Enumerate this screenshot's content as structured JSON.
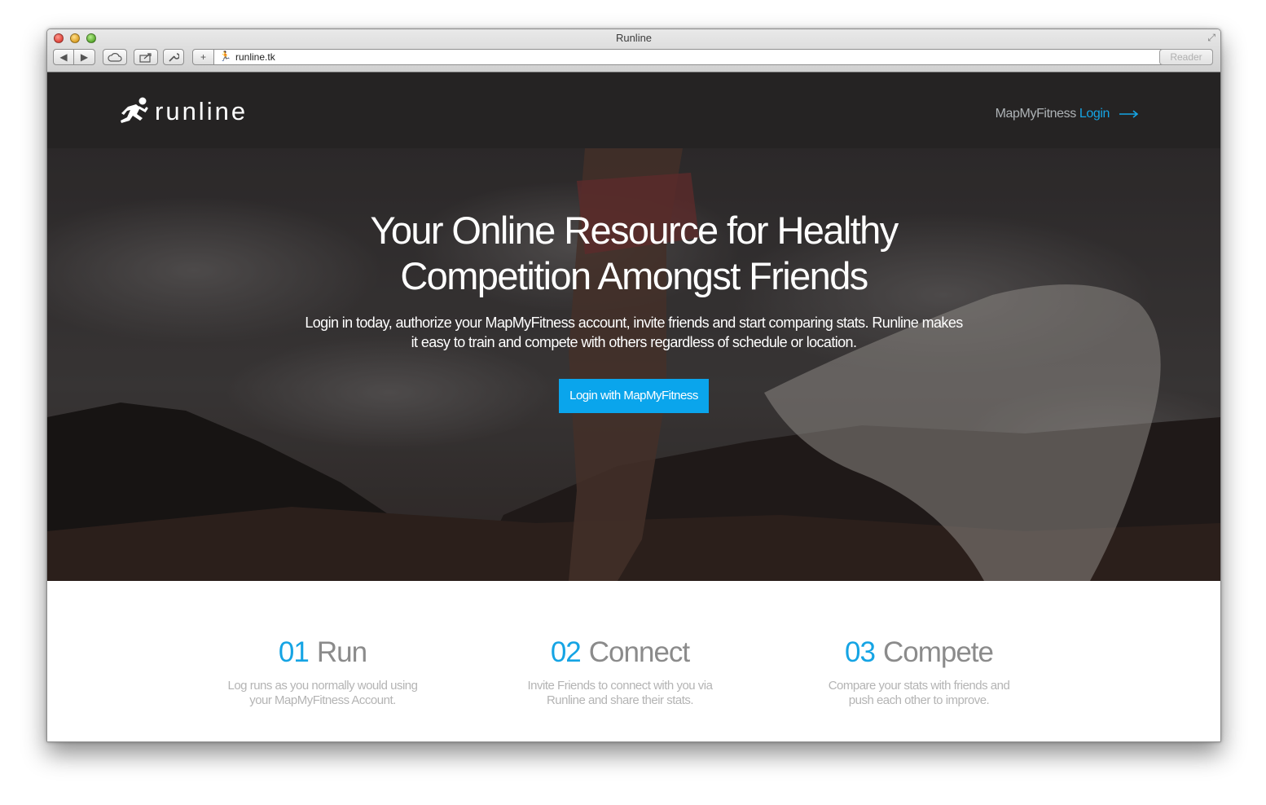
{
  "browser": {
    "window_title": "Runline",
    "url": "runline.tk",
    "reader_label": "Reader",
    "buttons": {
      "back": "◀",
      "forward": "▶",
      "new_tab": "+"
    }
  },
  "site": {
    "logo_text": "runline",
    "nav": {
      "prefix": "MapMyFitness",
      "login": "Login"
    },
    "hero": {
      "title_line1": "Your Online Resource for Healthy",
      "title_line2": "Competition Amongst Friends",
      "subtitle_line1": "Login in today, authorize your MapMyFitness account, invite friends and start comparing stats. Runline makes",
      "subtitle_line2": "it easy to train and compete with others regardless of schedule or location.",
      "cta": "Login with MapMyFitness"
    },
    "features": [
      {
        "num": "01",
        "name": "Run",
        "desc_line1": "Log runs as you normally would using",
        "desc_line2": "your MapMyFitness Account."
      },
      {
        "num": "02",
        "name": "Connect",
        "desc_line1": "Invite Friends to connect with you via",
        "desc_line2": "Runline and share their stats."
      },
      {
        "num": "03",
        "name": "Compete",
        "desc_line1": "Compare your stats with friends and",
        "desc_line2": "push each other to improve."
      }
    ]
  },
  "colors": {
    "accent": "#15a4e4",
    "button": "#0aa5ec",
    "header_bg": "#252323"
  },
  "icons": [
    "runner-icon",
    "arrow-right-icon",
    "icloud-icon",
    "share-icon",
    "tools-icon",
    "reload-icon",
    "fullscreen-icon"
  ]
}
